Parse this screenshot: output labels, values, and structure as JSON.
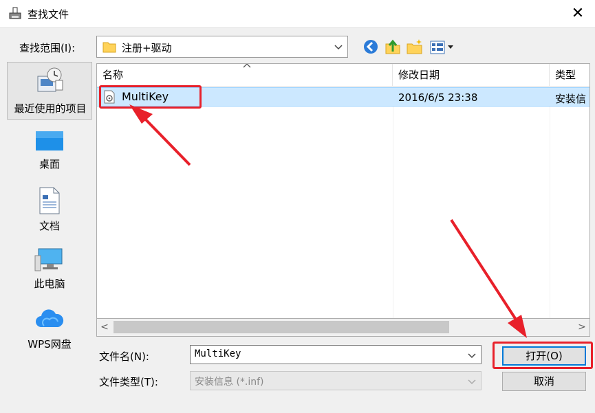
{
  "window": {
    "title": "查找文件",
    "close_label": "✕",
    "title_icon": "printer-file-icon"
  },
  "lookin": {
    "label": "查找范围(I):",
    "value": "注册+驱动"
  },
  "toolbar": {
    "icons": [
      "back-icon",
      "up-folder-icon",
      "new-folder-icon",
      "view-menu-icon"
    ]
  },
  "places": [
    {
      "label": "最近使用的项目",
      "icon": "recent-items-icon"
    },
    {
      "label": "桌面",
      "icon": "desktop-icon"
    },
    {
      "label": "文档",
      "icon": "documents-icon"
    },
    {
      "label": "此电脑",
      "icon": "this-pc-icon"
    },
    {
      "label": "WPS网盘",
      "icon": "wps-cloud-icon"
    }
  ],
  "list": {
    "columns": [
      "名称",
      "修改日期",
      "类型"
    ],
    "rows": [
      {
        "name": "MultiKey",
        "date": "2016/6/5 23:38",
        "type": "安装信"
      }
    ]
  },
  "scrollbar": {
    "left": "<",
    "right": ">"
  },
  "filename": {
    "label": "文件名(N):",
    "value": "MultiKey"
  },
  "filetype": {
    "label": "文件类型(T):",
    "value": "安装信息 (*.inf)"
  },
  "buttons": {
    "open": "打开(O)",
    "cancel": "取消"
  },
  "colors": {
    "annotation": "#e8202a",
    "selection": "#cce8ff",
    "accent": "#0078d7"
  }
}
